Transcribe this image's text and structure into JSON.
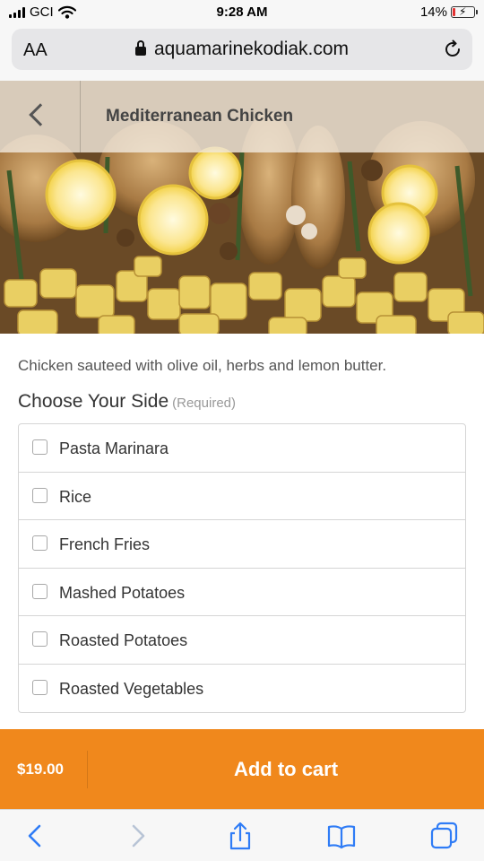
{
  "status_bar": {
    "carrier": "GCI",
    "time": "9:28 AM",
    "battery_percent": "14%",
    "battery_level": 0.14,
    "battery_color": "#e33333",
    "icons": [
      "signal-bars-icon",
      "wifi-icon",
      "battery-charging-icon"
    ]
  },
  "browser": {
    "text_size_label": "AA",
    "url": "aquamarinekodiak.com",
    "icons": [
      "lock-icon",
      "reload-icon"
    ]
  },
  "header": {
    "title": "Mediterranean Chicken",
    "back_icon": "chevron-left-icon"
  },
  "item": {
    "description": "Chicken sauteed with olive oil, herbs and lemon butter."
  },
  "side_choice": {
    "heading": "Choose Your Side",
    "required_label": "(Required)",
    "options": [
      {
        "label": "Pasta Marinara",
        "checked": false
      },
      {
        "label": "Rice",
        "checked": false
      },
      {
        "label": "French Fries",
        "checked": false
      },
      {
        "label": "Mashed Potatoes",
        "checked": false
      },
      {
        "label": "Roasted Potatoes",
        "checked": false
      },
      {
        "label": "Roasted Vegetables",
        "checked": false
      }
    ]
  },
  "cart": {
    "price": "$19.00",
    "button_label": "Add to cart",
    "accent_color": "#f0881c"
  },
  "toolbar": {
    "accent_color": "#2f7cf6",
    "icons": [
      "back-arrow-icon",
      "forward-arrow-icon",
      "share-icon",
      "bookmarks-icon",
      "tabs-icon"
    ]
  }
}
